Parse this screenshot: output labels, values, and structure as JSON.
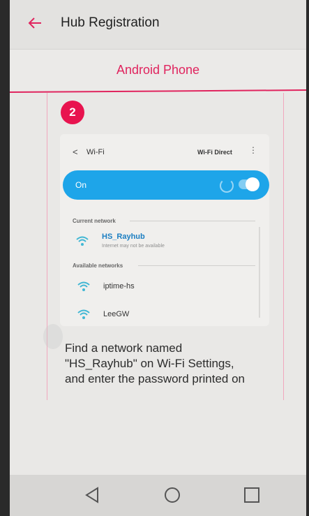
{
  "app_bar": {
    "title": "Hub Registration",
    "back_icon": "back-arrow-icon",
    "accent_color": "#e0245e"
  },
  "segment": {
    "title": "Android Phone"
  },
  "step": {
    "number": "2"
  },
  "wifi_screenshot": {
    "title": "Wi-Fi",
    "direct_label": "Wi-Fi Direct",
    "toggle_label": "On",
    "toggle_color": "#1ea5e9",
    "current_section": "Current network",
    "current_network": {
      "name": "HS_Rayhub",
      "status": "Internet may not be available"
    },
    "available_section": "Available networks",
    "available_networks": [
      {
        "name": "iptime-hs"
      },
      {
        "name": "LeeGW"
      }
    ]
  },
  "instructions": {
    "line1": "Find a network named",
    "line2": "\"HS_Rayhub\" on Wi-Fi Settings,",
    "line3": "and enter the password printed on"
  },
  "nav_bar": {
    "icons": [
      "back-triangle-icon",
      "home-circle-icon",
      "recent-square-icon"
    ]
  }
}
